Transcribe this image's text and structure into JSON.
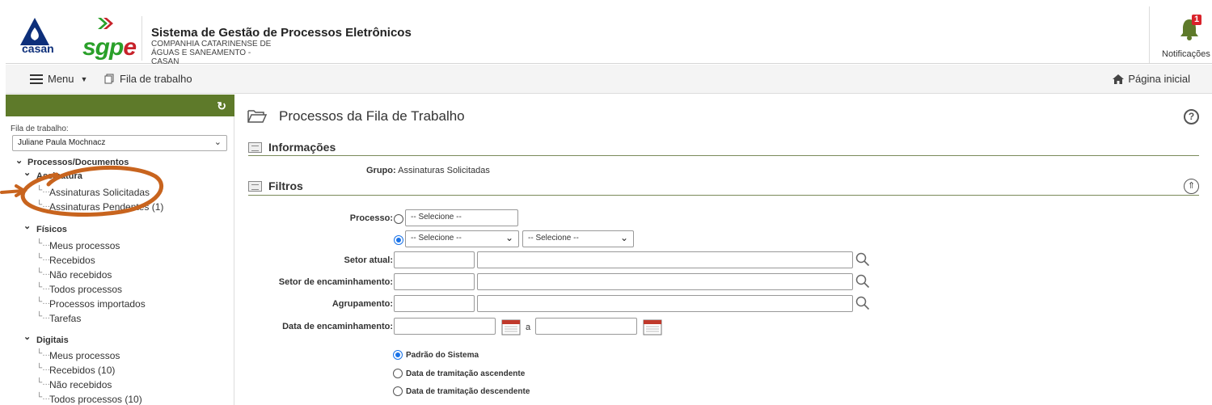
{
  "header": {
    "casan_logo_text": "casan",
    "sgpe_logo_text": "sgp",
    "sgpe_logo_e": "e",
    "system_title": "Sistema de Gestão de Processos Eletrônicos",
    "company_name": "COMPANHIA CATARINENSE DE ÁGUAS E SANEAMENTO - CASAN",
    "notifications_label": "Notificações",
    "notifications_count": "1"
  },
  "navbar": {
    "menu_label": "Menu",
    "fila_label": "Fila de trabalho",
    "home_label": "Página inicial"
  },
  "sidebar": {
    "fila_label": "Fila de trabalho:",
    "fila_value": "Juliane Paula Mochnacz",
    "tree": {
      "root": "Processos/Documentos",
      "assinatura": "Assinatura",
      "assinaturas_solicitadas": "Assinaturas Solicitadas",
      "assinaturas_pendentes": "Assinaturas Pendentes (1)",
      "fisicos": "Físicos",
      "fisicos_items": [
        "Meus processos",
        "Recebidos",
        "Não recebidos",
        "Todos processos",
        "Processos importados",
        "Tarefas"
      ],
      "digitais": "Digitais",
      "digitais_items": [
        "Meus processos",
        "Recebidos (10)",
        "Não recebidos",
        "Todos processos (10)"
      ]
    }
  },
  "main": {
    "title": "Processos da Fila de Trabalho",
    "informacoes": "Informações",
    "grupo_label": "Grupo:",
    "grupo_value": "Assinaturas Solicitadas",
    "filtros": "Filtros",
    "processo_label": "Processo:",
    "selecione": "-- Selecione --",
    "setor_atual_label": "Setor atual:",
    "setor_encaminhamento_label": "Setor de encaminhamento:",
    "agrupamento_label": "Agrupamento:",
    "data_encaminhamento_label": "Data de encaminhamento:",
    "a_sep": "a",
    "ordem_options": [
      "Padrão do Sistema",
      "Data de tramitação ascendente",
      "Data de tramitação descendente"
    ]
  },
  "colors": {
    "sidebar_bar": "#5e7a2a",
    "annotation": "#c8641e",
    "radio_checked": "#1a73e8",
    "badge": "#d9222a"
  }
}
